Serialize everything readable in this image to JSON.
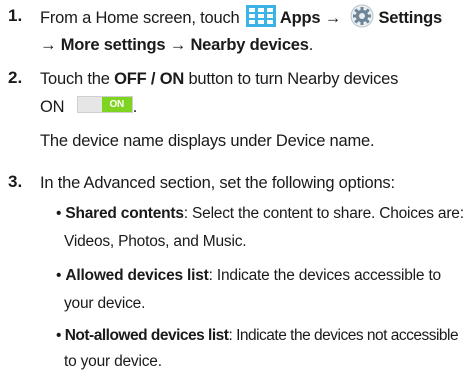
{
  "steps": [
    {
      "number": "1.",
      "line1_a": "From a Home screen, touch",
      "apps_label": "Apps",
      "arrow": "→",
      "settings_label": "Settings",
      "line2_a": "→",
      "more_settings": "More settings",
      "line2_arrow": "→",
      "nearby_devices": "Nearby devices",
      "line2_end": "."
    },
    {
      "number": "2.",
      "line1_a": "Touch the",
      "off_on": "OFF / ON",
      "line1_b": "button to turn Nearby devices",
      "line2_a": "ON",
      "toggle_label": "ON",
      "line2_end": ".",
      "note": "The device name displays under Device name."
    },
    {
      "number": "3.",
      "intro": "In the Advanced section, set the following options:",
      "bullets": [
        {
          "title": "Shared contents",
          "desc1": ": Select the content to share. Choices are:",
          "desc2": "Videos, Photos, and Music."
        },
        {
          "title": "Allowed devices list",
          "desc1": ": Indicate the devices accessible to",
          "desc2": "your device."
        },
        {
          "title": "Not-allowed devices list",
          "desc1": ": Indicate the devices not accessible",
          "desc2": "to your device."
        }
      ]
    }
  ],
  "icons": {
    "apps": "apps-grid-icon",
    "settings": "settings-gear-icon",
    "toggle_color": "#7fd321",
    "apps_color": "#3bb3e6"
  }
}
